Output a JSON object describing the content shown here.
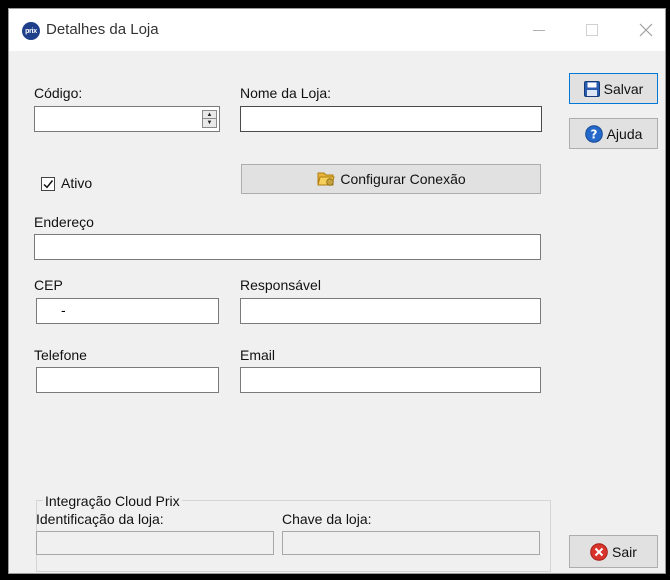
{
  "window": {
    "title": "Detalhes da Loja",
    "icon_text": "prix"
  },
  "form": {
    "codigo_label": "Código:",
    "codigo_value": "",
    "nome_label": "Nome da Loja:",
    "nome_value": "",
    "ativo_label": "Ativo",
    "ativo_checked": true,
    "configurar_label": "Configurar Conexão",
    "endereco_label": "Endereço",
    "endereco_value": "",
    "cep_label": "CEP",
    "cep_value": "-",
    "responsavel_label": "Responsável",
    "responsavel_value": "",
    "telefone_label": "Telefone",
    "telefone_value": "",
    "email_label": "Email",
    "email_value": ""
  },
  "integracao": {
    "title": "Integração Cloud Prix",
    "identificacao_label": "Identificação da loja:",
    "identificacao_value": "",
    "chave_label": "Chave da loja:",
    "chave_value": ""
  },
  "buttons": {
    "salvar": "Salvar",
    "ajuda": "Ajuda",
    "sair": "Sair"
  },
  "colors": {
    "salvar_icon": "#2a5db0",
    "ajuda_icon": "#2468c9",
    "sair_icon": "#d9342b",
    "folder_icon": "#e8b53a"
  }
}
